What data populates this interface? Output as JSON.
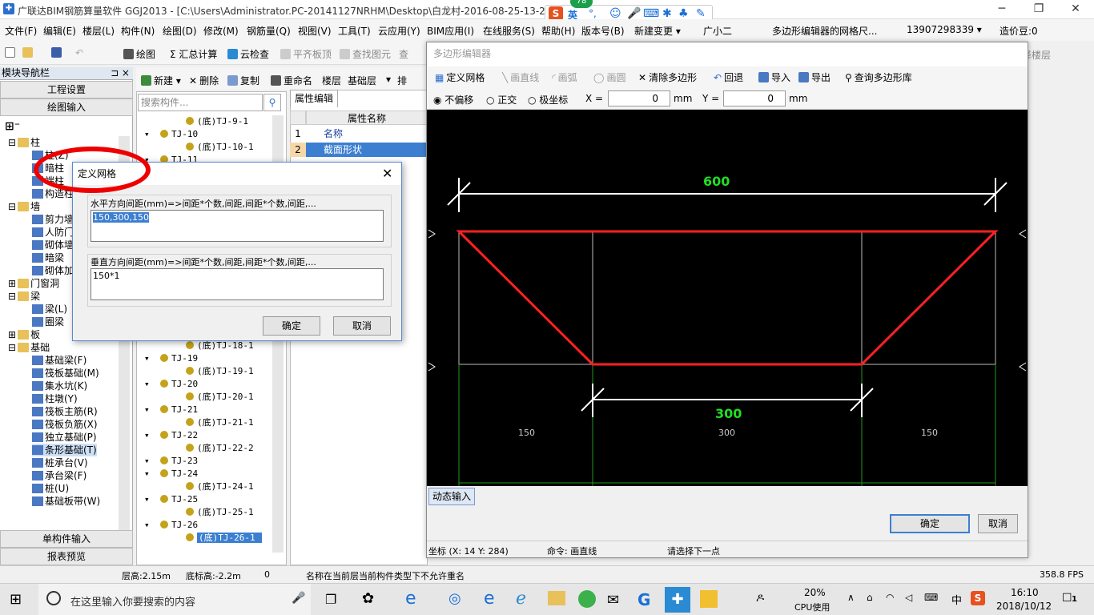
{
  "app": {
    "title": "广联达BIM钢筋算量软件 GGJ2013 - [C:\\Users\\Administrator.PC-20141127NRHM\\Desktop\\白龙村-2016-08-25-13-27",
    "icon": "app-logo-icon"
  },
  "window_controls": {
    "minimize": "─",
    "maximize": "❐",
    "close": "✕"
  },
  "ime": {
    "logo": "S",
    "lang": "英",
    "punct": "°,",
    "badge": "78"
  },
  "menu": [
    "文件(F)",
    "编辑(E)",
    "楼层(L)",
    "构件(N)",
    "绘图(D)",
    "修改(M)",
    "钢筋量(Q)",
    "视图(V)",
    "工具(T)",
    "云应用(Y)",
    "BIM应用(I)",
    "在线服务(S)",
    "帮助(H)",
    "版本号(B)",
    "新建变更 ▾",
    "广小二",
    "多边形编辑器的网格尺...",
    "13907298339 ▾",
    "造价豆:0"
  ],
  "toolbar": [
    "绘图",
    "Σ 汇总计算",
    "云检查",
    "平齐板顶",
    "查找图元",
    "查"
  ],
  "toolbar_right": "选择楼层",
  "left_panel": {
    "header": "模块导航栏",
    "pin": "⊐ ×",
    "btn_engineering": "工程设置",
    "btn_drawing": "绘图输入",
    "btn_single": "单构件输入",
    "btn_report": "报表预览",
    "tree": [
      {
        "label": "柱",
        "level": 0,
        "expand": "⊟"
      },
      {
        "label": "柱(Z)",
        "level": 1
      },
      {
        "label": "暗柱",
        "level": 1
      },
      {
        "label": "端柱",
        "level": 1
      },
      {
        "label": "构造柱",
        "level": 1
      },
      {
        "label": "墙",
        "level": 0,
        "expand": "⊟"
      },
      {
        "label": "剪力墙",
        "level": 1
      },
      {
        "label": "人防门框墙",
        "level": 1
      },
      {
        "label": "砌体墙",
        "level": 1
      },
      {
        "label": "暗梁",
        "level": 1
      },
      {
        "label": "砌体加筋",
        "level": 1
      },
      {
        "label": "门窗洞",
        "level": 0,
        "expand": "⊞"
      },
      {
        "label": "梁",
        "level": 0,
        "expand": "⊟"
      },
      {
        "label": "梁(L)",
        "level": 1
      },
      {
        "label": "圈梁",
        "level": 1
      },
      {
        "label": "板",
        "level": 0,
        "expand": "⊞"
      },
      {
        "label": "基础",
        "level": 0,
        "expand": "⊟"
      },
      {
        "label": "基础梁(F)",
        "level": 1
      },
      {
        "label": "筏板基础(M)",
        "level": 1
      },
      {
        "label": "集水坑(K)",
        "level": 1
      },
      {
        "label": "柱墩(Y)",
        "level": 1
      },
      {
        "label": "筏板主筋(R)",
        "level": 1
      },
      {
        "label": "筏板负筋(X)",
        "level": 1
      },
      {
        "label": "独立基础(P)",
        "level": 1
      },
      {
        "label": "条形基础(T)",
        "level": 1,
        "selected": true
      },
      {
        "label": "桩承台(V)",
        "level": 1
      },
      {
        "label": "承台梁(F)",
        "level": 1
      },
      {
        "label": "桩(U)",
        "level": 1
      },
      {
        "label": "基础板带(W)",
        "level": 1
      }
    ]
  },
  "mid_panel": {
    "tools": [
      "新建 ▾",
      "删除",
      "复制",
      "重命名",
      "楼层",
      "基础层",
      "▾",
      "排"
    ],
    "search_placeholder": "搜索构件...",
    "tree": [
      {
        "label": "(底)TJ-9-1",
        "level": 1
      },
      {
        "label": "TJ-10",
        "level": 0
      },
      {
        "label": "(底)TJ-10-1",
        "level": 1
      },
      {
        "label": "TJ-11",
        "level": 0
      },
      {
        "label": "(底)TJ-18-1",
        "level": 1
      },
      {
        "label": "TJ-19",
        "level": 0
      },
      {
        "label": "(底)TJ-19-1",
        "level": 1
      },
      {
        "label": "TJ-20",
        "level": 0
      },
      {
        "label": "(底)TJ-20-1",
        "level": 1
      },
      {
        "label": "TJ-21",
        "level": 0
      },
      {
        "label": "(底)TJ-21-1",
        "level": 1
      },
      {
        "label": "TJ-22",
        "level": 0
      },
      {
        "label": "(底)TJ-22-2",
        "level": 1
      },
      {
        "label": "TJ-23",
        "level": 0
      },
      {
        "label": "TJ-24",
        "level": 0
      },
      {
        "label": "(底)TJ-24-1",
        "level": 1
      },
      {
        "label": "TJ-25",
        "level": 0
      },
      {
        "label": "(底)TJ-25-1",
        "level": 1
      },
      {
        "label": "TJ-26",
        "level": 0
      },
      {
        "label": "(底)TJ-26-1",
        "level": 1,
        "selected": true
      }
    ]
  },
  "prop_panel": {
    "tab": "属性编辑",
    "header": "属性名称",
    "rows": [
      {
        "num": "1",
        "name": "名称"
      },
      {
        "num": "2",
        "name": "截面形状"
      }
    ]
  },
  "poly_editor": {
    "title": "多边形编辑器",
    "tools": [
      "定义网格",
      "画直线",
      "画弧",
      "画圆",
      "清除多边形",
      "回退",
      "导入",
      "导出",
      "查询多边形库"
    ],
    "modes": [
      "不偏移",
      "正交",
      "极坐标"
    ],
    "x_label": "X =",
    "x_value": "0",
    "y_label": "Y =",
    "y_value": "0",
    "unit": "mm",
    "dim_top": "600",
    "dim_bottom": "300",
    "grid_labels": [
      "150",
      "300",
      "150"
    ],
    "dynamic_input": "动态输入",
    "ok": "确定",
    "cancel": "取消",
    "status_coord": "坐标 (X: 14 Y: 284)",
    "status_cmd": "命令: 画直线",
    "status_hint": "请选择下一点"
  },
  "grid_dialog": {
    "title": "定义网格",
    "h_label": "水平方向间距(mm)=>间距*个数,间距,间距*个数,间距,...",
    "h_value": "150,300,150",
    "v_label": "垂直方向间距(mm)=>间距*个数,间距,间距*个数,间距,...",
    "v_value": "150*1",
    "ok": "确定",
    "cancel": "取消",
    "close": "✕"
  },
  "statusbar": {
    "floor_height": "层高:2.15m",
    "base_height": "底标高:-2.2m",
    "zero": "0",
    "message": "名称在当前层当前构件类型下不允许重名",
    "fps": "358.8 FPS"
  },
  "taskbar": {
    "search_placeholder": "在这里输入你要搜索的内容",
    "cpu_percent": "20%",
    "cpu_label": "CPU使用",
    "time": "16:10",
    "date": "2018/10/12",
    "lang": "中",
    "notify_count": "1"
  },
  "colors": {
    "polygon": "#ff2020",
    "dim_text": "#22dd22",
    "canvas_bg": "#000000",
    "grid_line": "#1f9a1f",
    "selection": "#3c7fd0",
    "annotation": "#ee0000"
  }
}
